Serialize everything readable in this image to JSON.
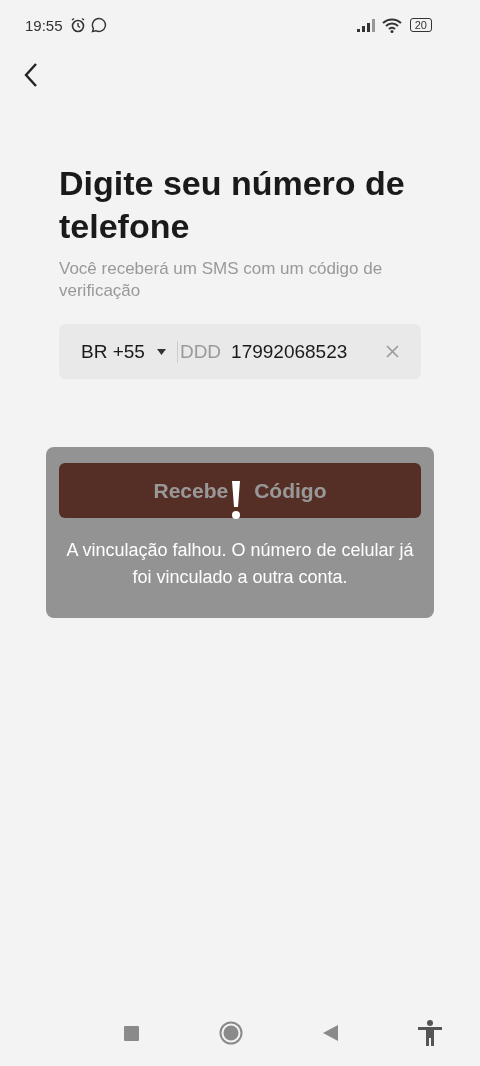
{
  "status_bar": {
    "time": "19:55",
    "battery": "20"
  },
  "title": "Digite seu número de telefone",
  "subtitle": "Você receberá um SMS com um código de verificação",
  "phone_field": {
    "country": "BR +55",
    "placeholder": "DDD",
    "value": "17992068523"
  },
  "button": {
    "label_start": "Recebe",
    "label_end": "Código"
  },
  "toast": {
    "message": "A vinculação falhou. O número de celular já foi vinculado a outra conta."
  }
}
